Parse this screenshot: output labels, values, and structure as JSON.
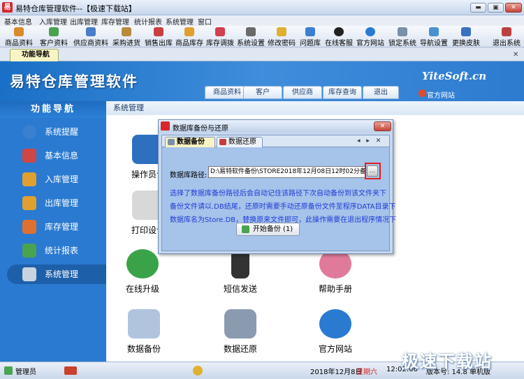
{
  "window": {
    "title": "易特仓库管理软件--【极速下载站】",
    "min_label": "▬",
    "max_label": "▣",
    "close_label": "✕"
  },
  "menu": [
    "基本信息",
    "入库管理",
    "出库管理",
    "库存管理",
    "统计报表",
    "系统管理",
    "窗口"
  ],
  "toolbar": [
    {
      "label": "商品资料",
      "icon": "goods-icon",
      "color": "#d98b2b"
    },
    {
      "label": "客户资料",
      "icon": "customer-icon",
      "color": "#4aa34f"
    },
    {
      "label": "供应商资料",
      "icon": "supplier-icon",
      "color": "#4a7cc7"
    },
    {
      "label": "采购进货",
      "icon": "purchase-icon",
      "color": "#b88a3c"
    },
    {
      "label": "销售出库",
      "icon": "sales-icon",
      "color": "#c94040"
    },
    {
      "label": "商品库存",
      "icon": "stock-icon",
      "color": "#e0a030"
    },
    {
      "label": "库存调拨",
      "icon": "transfer-icon",
      "color": "#d04050"
    },
    {
      "label": "系统设置",
      "icon": "settings-icon",
      "color": "#6a6a6a"
    },
    {
      "label": "修改密码",
      "icon": "password-icon",
      "color": "#e0b030"
    },
    {
      "label": "问题库",
      "icon": "question-icon",
      "color": "#3b7fd0"
    },
    {
      "label": "在线客服",
      "icon": "qq-icon",
      "color": "#222222"
    },
    {
      "label": "官方网站",
      "icon": "ie-icon",
      "color": "#2a7ad1"
    },
    {
      "label": "锁定系统",
      "icon": "lock-icon",
      "color": "#7a8fa8"
    },
    {
      "label": "导航设置",
      "icon": "nav-settings-icon",
      "color": "#4a90d0"
    },
    {
      "label": "更换皮肤",
      "icon": "skin-icon",
      "color": "#3a70c0"
    },
    {
      "label": "退出系统",
      "icon": "exit-icon",
      "color": "#c04040"
    }
  ],
  "tab": {
    "label": "功能导航",
    "close": "✕"
  },
  "banner": {
    "title": "易特仓库管理软件",
    "brand": "YiteSoft.cn",
    "site_link": "官方网站",
    "tabs": [
      "商品资料",
      "客户",
      "供应商",
      "库存查询",
      "退出"
    ]
  },
  "sidebar": {
    "title": "功能导航",
    "items": [
      {
        "label": "系统提醒",
        "icon": "info-icon",
        "color": "#3b7fd0"
      },
      {
        "label": "基本信息",
        "icon": "cubes-icon",
        "color": "#d04545"
      },
      {
        "label": "入库管理",
        "icon": "inbound-box-icon",
        "color": "#e0a030"
      },
      {
        "label": "出库管理",
        "icon": "outbound-box-icon",
        "color": "#e0a030"
      },
      {
        "label": "库存管理",
        "icon": "warehouse-icon",
        "color": "#e07030"
      },
      {
        "label": "统计报表",
        "icon": "bar-chart-icon",
        "color": "#4aa34f"
      },
      {
        "label": "系统管理",
        "icon": "tools-icon",
        "color": "#c9d3df"
      }
    ]
  },
  "main": {
    "breadcrumb": "系统管理",
    "functions": [
      {
        "label": "操作员设",
        "icon": "operator-icon",
        "color": "#2f6fc0"
      },
      {
        "label": "打印设计",
        "icon": "printer-icon",
        "color": "#d8d8d8"
      },
      {
        "label": "在线升级",
        "icon": "upgrade-icon",
        "color": "#3aa34a"
      },
      {
        "label": "短信发送",
        "icon": "phone-icon",
        "color": "#333333"
      },
      {
        "label": "帮助手册",
        "icon": "help-icon",
        "color": "#e07a9a"
      },
      {
        "label": "数据备份",
        "icon": "calendar-icon",
        "color": "#b0c4de"
      },
      {
        "label": "数据还原",
        "icon": "database-icon",
        "color": "#8a9bb0"
      },
      {
        "label": "官方网站",
        "icon": "ie-icon",
        "color": "#2a7ad1"
      }
    ]
  },
  "dialog": {
    "title": "数据库备份与还原",
    "close": "✕",
    "tabs": [
      "数据备份",
      "数据还原"
    ],
    "tab_nav": "◂ ▸ ✕",
    "path_label": "数据库路径:",
    "path_value": "D:\\易特软件备份\\STORE2018年12月08日12时02分备份.DB",
    "browse": "…",
    "hints": [
      "选择了数据库备份路径后会自动记住该路径下次自动备份到该文件夹下",
      "备份文件请以.DB结尾，还原时需要手动还原备份文件至程序DATA目录下",
      "数据库名为Store.DB，替换原来文件即可，此操作需要在退出程序情况下"
    ],
    "backup_button": "开始备份 (1)"
  },
  "status": {
    "user": "管理员",
    "date": "2018年12月8日",
    "weekday": "星期六",
    "time": "12:02:06",
    "version": "版本号: 14.8 单机版"
  },
  "watermark": "极速下载站"
}
